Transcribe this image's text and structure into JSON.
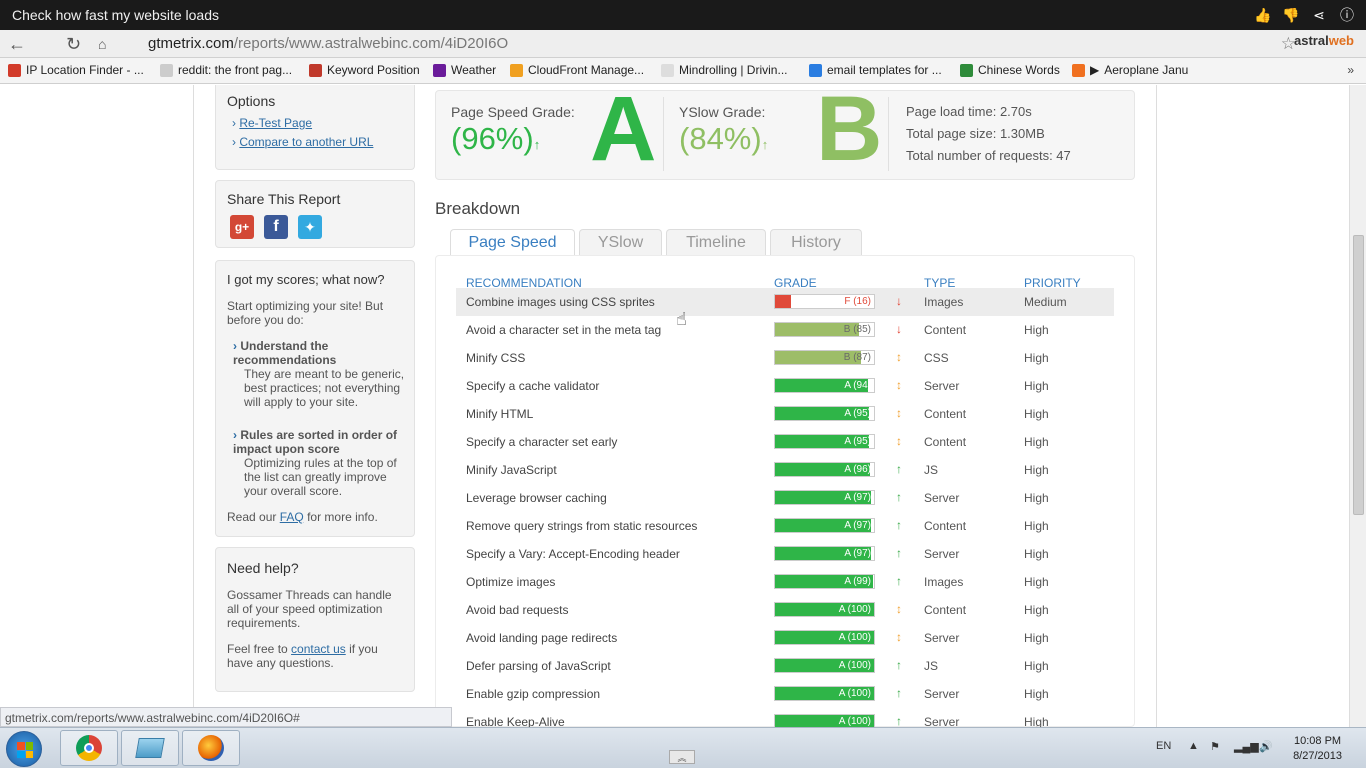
{
  "video": {
    "title": "Check how fast my website loads"
  },
  "browser": {
    "url_host": "gtmetrix.com",
    "url_path": "/reports/www.astralwebinc.com/4iD20I6O",
    "extension": {
      "a": "astral",
      "b": "web"
    }
  },
  "bookmarks": [
    {
      "label": "IP Location Finder - ...",
      "color": "#d23b2a"
    },
    {
      "label": "reddit: the front pag...",
      "color": "#cccccc"
    },
    {
      "label": "Keyword Position",
      "color": "#c0392b"
    },
    {
      "label": "Weather",
      "color": "#6a1b9a"
    },
    {
      "label": "CloudFront Manage...",
      "color": "#f0a020"
    },
    {
      "label": "Mindrolling | Drivin...",
      "color": "#dddddd"
    },
    {
      "label": "email templates for ...",
      "color": "#2a7de1"
    },
    {
      "label": "Chinese Words",
      "color": "#2e8b3a"
    },
    {
      "label": "Aeroplane Janu",
      "color": "#f07020"
    }
  ],
  "sidebar": {
    "options": {
      "title": "Options",
      "retest": "Re-Test Page",
      "compare": "Compare to another URL"
    },
    "share": {
      "title": "Share This Report"
    },
    "scores": {
      "title": "I got my scores; what now?",
      "intro": "Start optimizing your site! But before you do:",
      "item1_title": "Understand the recommendations",
      "item1_body": "They are meant to be generic, best practices; not everything will apply to your site.",
      "item2_title": "Rules are sorted in order of impact upon score",
      "item2_body": "Optimizing rules at the top of the list can greatly improve your overall score.",
      "faq_pre": "Read our",
      "faq_link": "FAQ",
      "faq_post": "for more info."
    },
    "help": {
      "title": "Need help?",
      "body": "Gossamer Threads can handle all of your speed optimization requirements.",
      "contact_pre": "Feel free to",
      "contact_link": "contact us",
      "contact_post": "if you have any questions."
    }
  },
  "summary": {
    "pagespeed_label": "Page Speed Grade:",
    "pagespeed_pct": "(96%)",
    "pagespeed_letter": "A",
    "yslow_label": "YSlow Grade:",
    "yslow_pct": "(84%)",
    "yslow_letter": "B",
    "load_time": "Page load time: 2.70s",
    "page_size": "Total page size: 1.30MB",
    "requests": "Total number of requests: 47",
    "color_a": "#2fb548",
    "color_b": "#8fbf63"
  },
  "breakdown": {
    "title": "Breakdown",
    "tabs": [
      "Page Speed",
      "YSlow",
      "Timeline",
      "History"
    ],
    "headers": {
      "rec": "RECOMMENDATION",
      "grade": "GRADE",
      "type": "TYPE",
      "priority": "PRIORITY"
    },
    "rows": [
      {
        "rec": "Combine images using CSS sprites",
        "grade": "F (16)",
        "score": 16,
        "arrow": "↓",
        "arrow_color": "#e04030",
        "type": "Images",
        "priority": "Medium"
      },
      {
        "rec": "Avoid a character set in the meta tag",
        "grade": "B (85)",
        "score": 85,
        "arrow": "↓",
        "arrow_color": "#e04030",
        "type": "Content",
        "priority": "High"
      },
      {
        "rec": "Minify CSS",
        "grade": "B (87)",
        "score": 87,
        "arrow": "↕",
        "arrow_color": "#f0a030",
        "type": "CSS",
        "priority": "High"
      },
      {
        "rec": "Specify a cache validator",
        "grade": "A (94)",
        "score": 94,
        "arrow": "↕",
        "arrow_color": "#f0a030",
        "type": "Server",
        "priority": "High"
      },
      {
        "rec": "Minify HTML",
        "grade": "A (95)",
        "score": 95,
        "arrow": "↕",
        "arrow_color": "#f0a030",
        "type": "Content",
        "priority": "High"
      },
      {
        "rec": "Specify a character set early",
        "grade": "A (95)",
        "score": 95,
        "arrow": "↕",
        "arrow_color": "#f0a030",
        "type": "Content",
        "priority": "High"
      },
      {
        "rec": "Minify JavaScript",
        "grade": "A (96)",
        "score": 96,
        "arrow": "↑",
        "arrow_color": "#3aaa4a",
        "type": "JS",
        "priority": "High"
      },
      {
        "rec": "Leverage browser caching",
        "grade": "A (97)",
        "score": 97,
        "arrow": "↑",
        "arrow_color": "#3aaa4a",
        "type": "Server",
        "priority": "High"
      },
      {
        "rec": "Remove query strings from static resources",
        "grade": "A (97)",
        "score": 97,
        "arrow": "↑",
        "arrow_color": "#3aaa4a",
        "type": "Content",
        "priority": "High"
      },
      {
        "rec": "Specify a Vary: Accept-Encoding header",
        "grade": "A (97)",
        "score": 97,
        "arrow": "↑",
        "arrow_color": "#3aaa4a",
        "type": "Server",
        "priority": "High"
      },
      {
        "rec": "Optimize images",
        "grade": "A (99)",
        "score": 99,
        "arrow": "↑",
        "arrow_color": "#3aaa4a",
        "type": "Images",
        "priority": "High"
      },
      {
        "rec": "Avoid bad requests",
        "grade": "A (100)",
        "score": 100,
        "arrow": "↕",
        "arrow_color": "#f0a030",
        "type": "Content",
        "priority": "High"
      },
      {
        "rec": "Avoid landing page redirects",
        "grade": "A (100)",
        "score": 100,
        "arrow": "↕",
        "arrow_color": "#f0a030",
        "type": "Server",
        "priority": "High"
      },
      {
        "rec": "Defer parsing of JavaScript",
        "grade": "A (100)",
        "score": 100,
        "arrow": "↑",
        "arrow_color": "#3aaa4a",
        "type": "JS",
        "priority": "High"
      },
      {
        "rec": "Enable gzip compression",
        "grade": "A (100)",
        "score": 100,
        "arrow": "↑",
        "arrow_color": "#3aaa4a",
        "type": "Server",
        "priority": "High"
      },
      {
        "rec": "Enable Keep-Alive",
        "grade": "A (100)",
        "score": 100,
        "arrow": "↑",
        "arrow_color": "#3aaa4a",
        "type": "Server",
        "priority": "High"
      }
    ]
  },
  "status_url": "gtmetrix.com/reports/www.astralwebinc.com/4iD20I6O#",
  "taskbar": {
    "lang": "EN",
    "time": "10:08 PM",
    "date": "8/27/2013"
  }
}
